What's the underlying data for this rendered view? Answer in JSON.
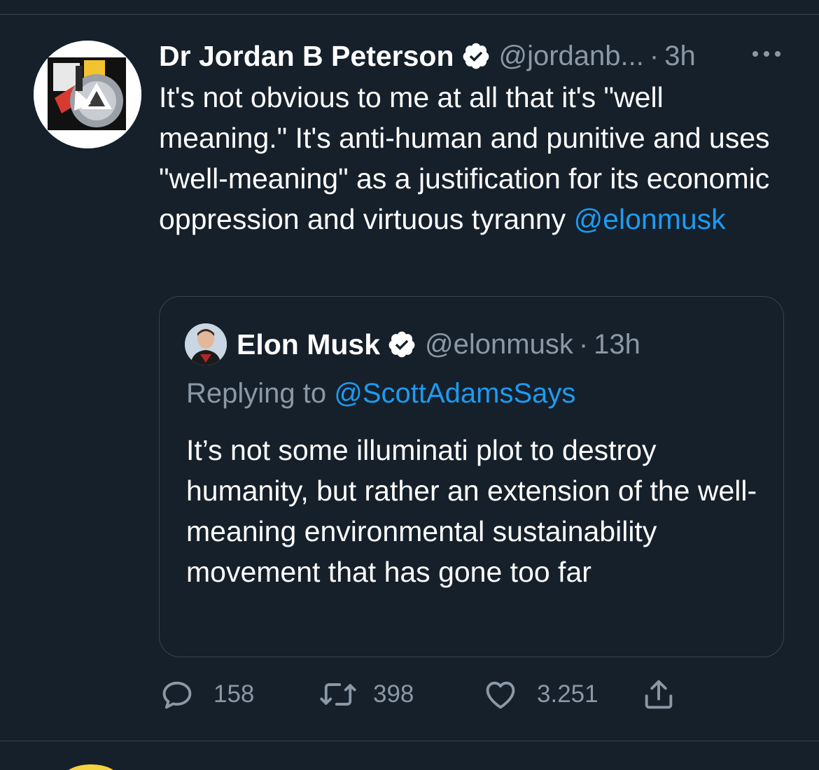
{
  "tweet": {
    "author_name": "Dr Jordan B Peterson",
    "handle": "@jordanb...",
    "separator": "·",
    "time": "3h",
    "more_icon": "more-horizontal-icon",
    "text": "It's not obvious to me at all that it's \"well meaning.\" It's anti-human and punitive and uses \"well-meaning\" as a justification for its economic oppression and virtuous tyranny ",
    "mention": "@elonmusk"
  },
  "quote": {
    "author_name": "Elon Musk",
    "handle": "@elonmusk",
    "separator": "·",
    "time": "13h",
    "replying_prefix": "Replying to ",
    "replying_to": "@ScottAdamsSays",
    "text": "It’s not some illuminati plot to destroy humanity, but rather an extension of the well-meaning environmental sustainability movement that has gone too far"
  },
  "actions": {
    "reply_count": "158",
    "retweet_count": "398",
    "like_count": "3.251"
  },
  "colors": {
    "background": "#15202b",
    "text": "#ffffff",
    "muted": "#8b98a5",
    "link": "#1d9bf0",
    "border": "#38444d"
  }
}
